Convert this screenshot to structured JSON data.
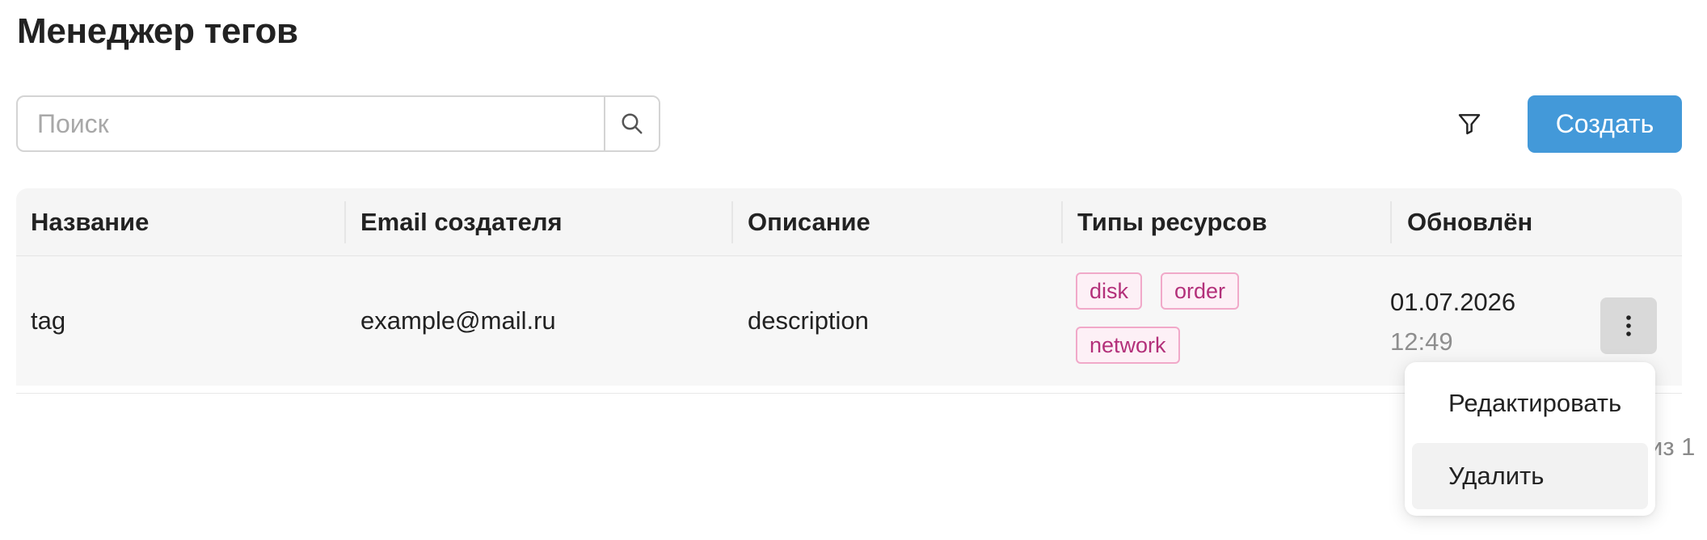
{
  "page": {
    "title": "Менеджер тегов"
  },
  "toolbar": {
    "search_placeholder": "Поиск",
    "search_value": "",
    "create_label": "Создать"
  },
  "icons": {
    "search": "search-icon",
    "filter": "filter-icon",
    "more": "more-vertical-icon"
  },
  "colors": {
    "primary": "#4399d9",
    "tag_text": "#b3307a",
    "tag_border": "#f1a9c9"
  },
  "table": {
    "columns": [
      "Название",
      "Email создателя",
      "Описание",
      "Типы ресурсов",
      "Обновлён"
    ],
    "rows": [
      {
        "name": "tag",
        "email": "example@mail.ru",
        "description": "description",
        "resource_types": [
          "disk",
          "order",
          "network"
        ],
        "updated_date": "01.07.2026",
        "updated_time": "12:49"
      }
    ]
  },
  "pagination": {
    "text": "из 1"
  },
  "row_menu": {
    "items": [
      "Редактировать",
      "Удалить"
    ]
  }
}
